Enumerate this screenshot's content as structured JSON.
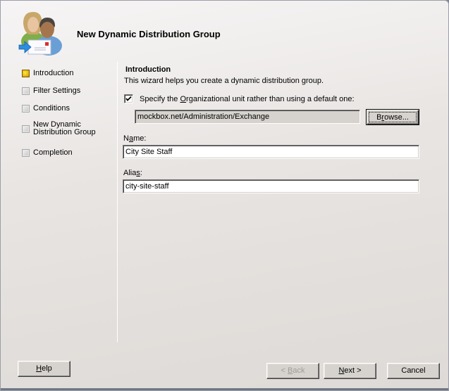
{
  "window": {
    "title": "New Dynamic Distribution Group",
    "header_icon": "users-mail-icon"
  },
  "nav": {
    "items": [
      {
        "label": "Introduction",
        "state": "active"
      },
      {
        "label": "Filter Settings",
        "state": "pending"
      },
      {
        "label": "Conditions",
        "state": "pending"
      },
      {
        "label_line1": "New Dynamic",
        "label_line2": "Distribution Group",
        "state": "pending"
      },
      {
        "label": "Completion",
        "state": "pending"
      }
    ]
  },
  "page": {
    "title": "Introduction",
    "description": "This wizard helps you create a dynamic distribution group.",
    "ou_checkbox": {
      "checked": true,
      "label_pre": "Specify the ",
      "label_accel": "O",
      "label_post": "rganizational unit rather than using a default one:"
    },
    "ou_value": "mockbox.net/Administration/Exchange",
    "browse_label_accel": "r",
    "browse_label_pre": "B",
    "browse_label_post": "owse...",
    "name": {
      "label_pre": "N",
      "label_accel": "a",
      "label_post": "me:",
      "value": "City Site Staff"
    },
    "alias": {
      "label_pre": "Alia",
      "label_accel": "s",
      "label_post": ":",
      "value": "city-site-staff"
    }
  },
  "footer": {
    "help": {
      "accel": "H",
      "rest": "elp"
    },
    "back": {
      "pre": "< ",
      "accel": "B",
      "rest": "ack",
      "enabled": false
    },
    "next": {
      "accel": "N",
      "rest": "ext >"
    },
    "cancel": "Cancel"
  }
}
